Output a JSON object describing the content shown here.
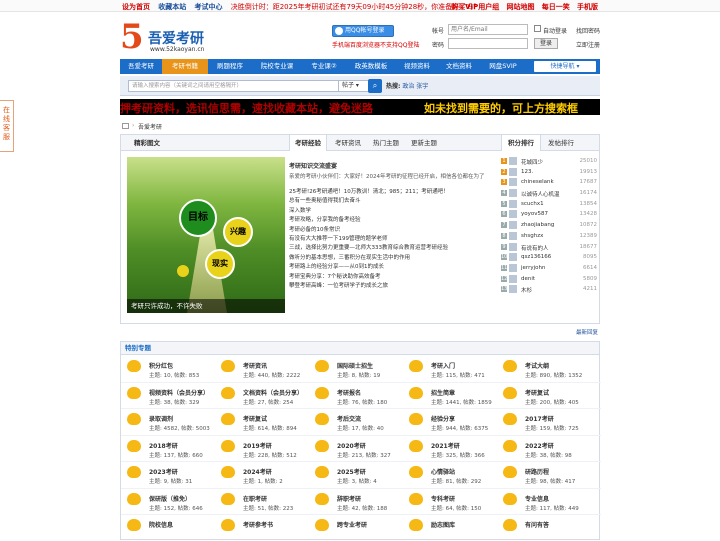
{
  "topbar": {
    "links": [
      "设为首页",
      "收藏本站",
      "考试中心"
    ],
    "countdown": "决胜倒计时：距2025年考研初试还有79天09小时45分钟28秒，你准备好了吗？",
    "right_links": [
      "购买VIP用户组",
      "网站地图",
      "每日一笑",
      "手机版"
    ]
  },
  "logo": {
    "digit": "5",
    "name": "吾爱考研",
    "url": "www.52kaoyan.cn"
  },
  "qq": {
    "label": "用QQ帐号登录",
    "tip": "手机端百度浏览器不支持QQ登陆"
  },
  "login": {
    "account_label": "帐号",
    "account_placeholder": "用户名/Email",
    "password_label": "密码",
    "remember": "自动登录",
    "forgot": "找回密码",
    "login_btn": "登录",
    "register": "立即注册"
  },
  "nav": {
    "items": [
      "吾爱考研",
      "考研书籍",
      "刷题程序",
      "院校专业课",
      "专业课②",
      "政英数模板",
      "视频资料",
      "文档资料",
      "网盘SVIP"
    ],
    "quick": "快捷导航"
  },
  "search": {
    "placeholder": "请输入搜索内容（关键词之间请用空格隔开）",
    "type": "帖子",
    "hot_label": "热搜:",
    "hot_terms": [
      "政治",
      "张宇"
    ]
  },
  "banner": {
    "left": "押考研资料，选讯信思需，速找收藏本站，避免迷路",
    "right": "如未找到需要的，可上方搜索框"
  },
  "breadcrumb": {
    "sep": "›",
    "current": "吾爱考研"
  },
  "side_widget": {
    "label": "在线客服"
  },
  "tabs": {
    "photo_tab": "精彩图文",
    "main": [
      "考研经验",
      "考研资讯",
      "热门主题",
      "更新主题"
    ],
    "rank": [
      "积分排行",
      "发帖排行"
    ]
  },
  "photo": {
    "c1": "目标",
    "c2": "兴趣",
    "c3": "现实",
    "caption": "考研只许成功，不许失败"
  },
  "articles": {
    "headline": "考研知识交流盛宴",
    "intro": "亲爱的考研小伙伴们：大家好！2024年考研的征程已经开启，相信各位都在为了",
    "list": [
      "25考研!26考研通吧！10万教训！清北；985；211；考研通吧！",
      "总有一些奥秘值得我们去奋斗",
      "深入数学",
      "考研攻略，分享我的备考经验",
      "考研必备的10条常识",
      "有没有大大推荐一下199管理的题学老师",
      "三战，选择比努力更重要—北师大333教育综合教育运营考研经验",
      "做听分的基本思想，三番积分在现实生活中的作用",
      "考研路上的经验分享——从0到1的成长",
      "考研宝典分享：7个秘诀助你高效备考",
      "攀登考研高峰：一位考研学子的成长之旅"
    ]
  },
  "rank": [
    {
      "name": "花城四少",
      "score": "25010"
    },
    {
      "name": "123.",
      "score": "19913"
    },
    {
      "name": "chineselank",
      "score": "17687"
    },
    {
      "name": "以诚待人心机温",
      "score": "16174"
    },
    {
      "name": "scuchx1",
      "score": "13854"
    },
    {
      "name": "yoyov587",
      "score": "13428"
    },
    {
      "name": "zhaojiabang",
      "score": "10872"
    },
    {
      "name": "shsghzx",
      "score": "12389"
    },
    {
      "name": "有说有的人",
      "score": "18677"
    },
    {
      "name": "qsz136166",
      "score": "8095"
    },
    {
      "name": "jerryjohn",
      "score": "6614"
    },
    {
      "name": "denit",
      "score": "5809"
    },
    {
      "name": "木杉",
      "score": "4211"
    }
  ],
  "more_label": "最新回复",
  "special": {
    "title": "特别专题",
    "items": [
      {
        "name": "积分红包",
        "stats": "主题: 10, 帖数: 853"
      },
      {
        "name": "考研资讯",
        "stats": "主题: 440, 帖数: 2222"
      },
      {
        "name": "国际硕士招生",
        "stats": "主题: 8, 帖数: 19"
      },
      {
        "name": "考研入门",
        "stats": "主题: 115, 帖数: 471"
      },
      {
        "name": "考试大纲",
        "stats": "主题: 890, 帖数: 1352"
      },
      {
        "name": "视频资料（会员分享）",
        "stats": "主题: 38, 帖数: 329"
      },
      {
        "name": "文档资料（会员分享）",
        "stats": "主题: 27, 帖数: 254"
      },
      {
        "name": "考研报名",
        "stats": "主题: 76, 帖数: 180"
      },
      {
        "name": "招生简章",
        "stats": "主题: 1441, 帖数: 1859"
      },
      {
        "name": "考研复试",
        "stats": "主题: 200, 帖数: 405"
      },
      {
        "name": "录取调剂",
        "stats": "主题: 4582, 帖数: 5003"
      },
      {
        "name": "考研复试",
        "stats": "主题: 614, 帖数: 894"
      },
      {
        "name": "考后交流",
        "stats": "主题: 17, 帖数: 40"
      },
      {
        "name": "经验分享",
        "stats": "主题: 944, 帖数: 6375"
      },
      {
        "name": "2017考研",
        "stats": "主题: 159, 帖数: 725"
      },
      {
        "name": "2018考研",
        "stats": "主题: 137, 帖数: 660"
      },
      {
        "name": "2019考研",
        "stats": "主题: 228, 帖数: 512"
      },
      {
        "name": "2020考研",
        "stats": "主题: 213, 帖数: 327"
      },
      {
        "name": "2021考研",
        "stats": "主题: 325, 帖数: 366"
      },
      {
        "name": "2022考研",
        "stats": "主题: 38, 帖数: 98"
      },
      {
        "name": "2023考研",
        "stats": "主题: 9, 帖数: 31"
      },
      {
        "name": "2024考研",
        "stats": "主题: 1, 帖数: 2"
      },
      {
        "name": "2025考研",
        "stats": "主题: 3, 帖数: 4"
      },
      {
        "name": "心情驿站",
        "stats": "主题: 81, 帖数: 292"
      },
      {
        "name": "研路历程",
        "stats": "主题: 98, 帖数: 417"
      },
      {
        "name": "保研版（推免）",
        "stats": "主题: 152, 帖数: 646"
      },
      {
        "name": "在职考研",
        "stats": "主题: 51, 帖数: 223"
      },
      {
        "name": "辞职考研",
        "stats": "主题: 42, 帖数: 188"
      },
      {
        "name": "专科考研",
        "stats": "主题: 64, 帖数: 150"
      },
      {
        "name": "专业信息",
        "stats": "主题: 117, 帖数: 449"
      },
      {
        "name": "院校信息",
        "stats": ""
      },
      {
        "name": "考研参考书",
        "stats": ""
      },
      {
        "name": "跨专业考研",
        "stats": ""
      },
      {
        "name": "励志图库",
        "stats": ""
      },
      {
        "name": "有问有答",
        "stats": ""
      }
    ]
  },
  "colors": {
    "nav": "#1c6dc7",
    "active": "#e8941a",
    "accent_red": "#d40000"
  }
}
